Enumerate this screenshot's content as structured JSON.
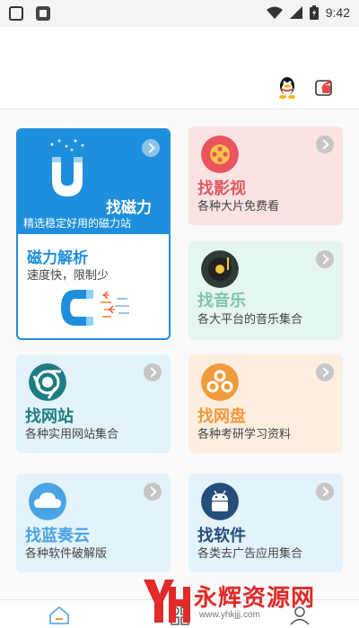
{
  "status_bar": {
    "time": "9:42"
  },
  "cards": {
    "magnet": {
      "title": "找磁力",
      "subtitle": "精选稳定好用的磁力站",
      "color": "#1e8fdd"
    },
    "magnet_parse": {
      "title": "磁力解析",
      "subtitle": "速度快，限制少"
    },
    "movie": {
      "title": "找影视",
      "subtitle": "各种大片免费看",
      "title_color": "#e25a63"
    },
    "music": {
      "title": "找音乐",
      "subtitle": "各大平台的音乐集合",
      "title_color": "#7fc4a8"
    },
    "website": {
      "title": "找网站",
      "subtitle": "各种实用网站集合",
      "title_color": "#1f7e86"
    },
    "netdisk": {
      "title": "找网盘",
      "subtitle": "各种考研学习资料",
      "title_color": "#f2993a"
    },
    "lanzou": {
      "title": "找蓝奏云",
      "subtitle": "各种软件破解版",
      "title_color": "#4aa3e3"
    },
    "software": {
      "title": "找软件",
      "subtitle": "各类去广告应用集合",
      "title_color": "#264e7a"
    }
  },
  "bottom_nav": [
    "home-icon",
    "apps-icon",
    "profile-icon"
  ],
  "watermark": {
    "title": "永辉资源网",
    "url": "www.yhkjjj.com"
  }
}
